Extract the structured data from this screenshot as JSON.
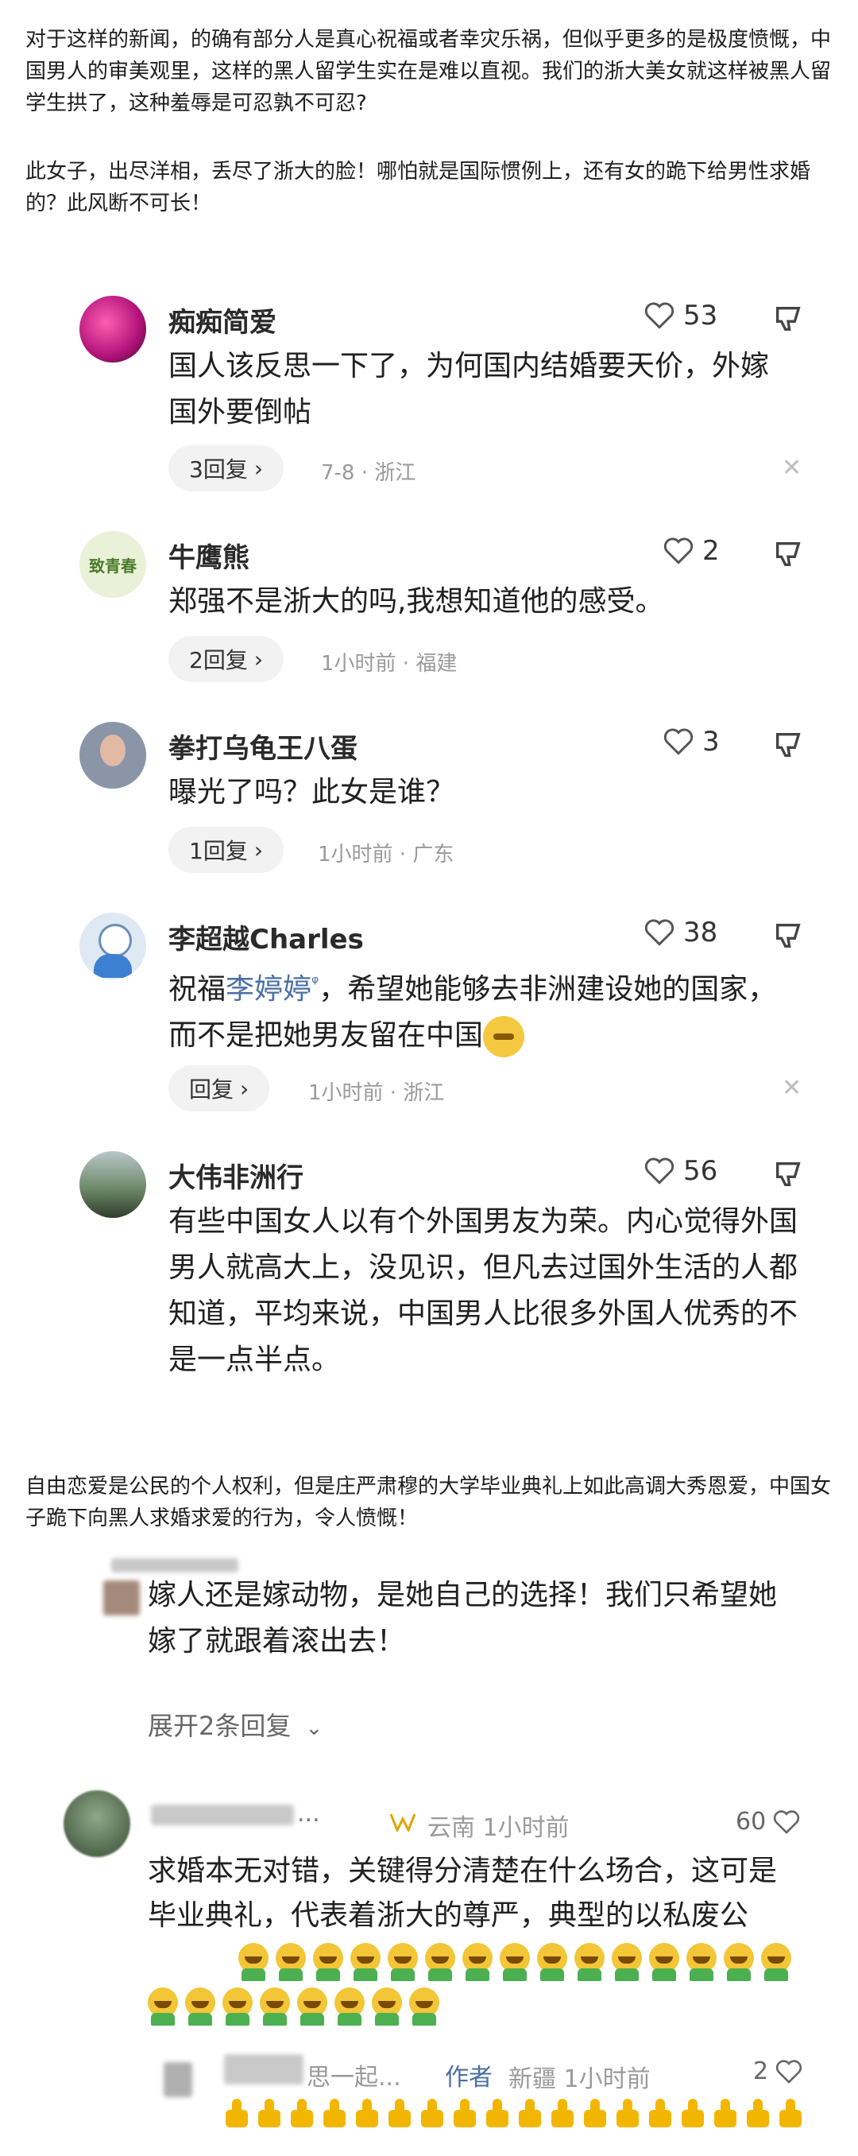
{
  "intro": {
    "p1": "对于这样的新闻，的确有部分人是真心祝福或者幸灾乐祸，但似乎更多的是极度愤慨，中国男人的审美观里，这样的黑人留学生实在是难以直视。我们的浙大美女就这样被黑人留学生拱了，这种羞辱是可忍孰不可忍?",
    "p2": "此女子，出尽洋相，丢尽了浙大的脸！哪怕就是国际惯例上，还有女的跪下给男性求婚的？此风断不可长！"
  },
  "comments": [
    {
      "user": "痴痴简爱",
      "text": "国人该反思一下了，为何国内结婚要天价，外嫁国外要倒帖",
      "likes": "53",
      "replies": "3回复",
      "chevron": "›",
      "date": "7-8",
      "location": "浙江"
    },
    {
      "user": "牛鹰熊",
      "text": "郑强不是浙大的吗,我想知道他的感受。",
      "likes": "2",
      "replies": "2回复",
      "chevron": "›",
      "date": "1小时前",
      "location": "福建",
      "avatar_text": "致青春"
    },
    {
      "user": "拳打乌龟王八蛋",
      "text": "曝光了吗？此女是谁？",
      "likes": "3",
      "replies": "1回复",
      "chevron": "›",
      "date": "1小时前",
      "location": "广东"
    },
    {
      "user": "李超越Charles",
      "text_pre": "祝福",
      "mention": "李婷婷",
      "mention_icon": "ᵠ",
      "text_post": "，希望她能够去非洲建设她的国家，而不是把她男友留在中国",
      "likes": "38",
      "replies": "回复",
      "chevron": "›",
      "date": "1小时前",
      "location": "浙江"
    },
    {
      "user": "大伟非洲行",
      "text": "有些中国女人以有个外国男友为荣。内心觉得外国男人就高大上，没见识，但凡去过国外生活的人都知道，平均来说，中国男人比很多外国人优秀的不是一点半点。",
      "likes": "56"
    }
  ],
  "middle_para": "自由恋爱是公民的个人权利，但是庄严肃穆的大学毕业典礼上如此高调大秀恩爱，中国女子跪下向黑人求婚求爱的行为，令人愤慨！",
  "second_screenshot": {
    "comment_a": {
      "text": "嫁人还是嫁动物，是她自己的选择！我们只希望她嫁了就跟着滚出去！",
      "expand": "展开2条回复"
    },
    "comment_b": {
      "name_tail": "...",
      "location": "云南",
      "time": "1小时前",
      "likes": "60",
      "text": "求婚本无对错，关键得分清楚在什么场合，这可是毕业典礼，代表着浙大的尊严，典型的以私废公"
    },
    "comment_c": {
      "name_tail": "思一起...",
      "author_tag": "作者",
      "location": "新疆",
      "time": "1小时前",
      "likes": "2"
    }
  },
  "colors": {
    "accent": "#4a6fa5",
    "meta": "#9a9a9a",
    "pill": "#f2f2f2"
  }
}
